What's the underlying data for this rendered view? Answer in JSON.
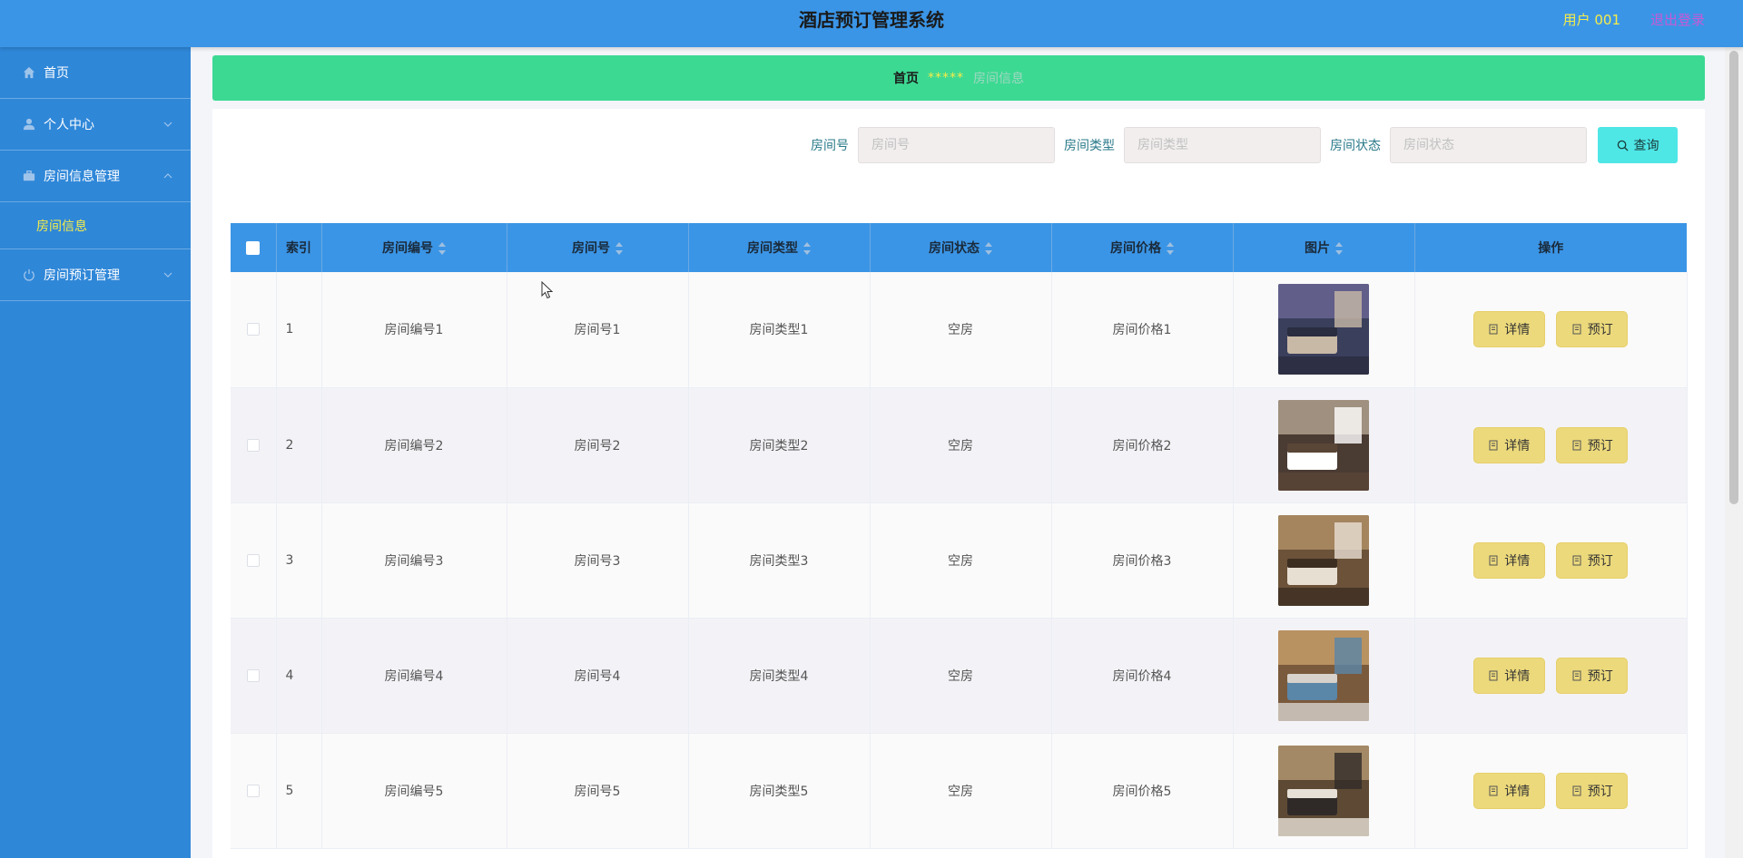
{
  "header": {
    "title": "酒店预订管理系统",
    "user": "用户 001",
    "logout": "退出登录",
    "bg_color": "#3b95e6",
    "user_color": "#f5ec4a",
    "logout_color": "#c65ad6"
  },
  "sidebar": {
    "bg_color": "#2f87d8",
    "items": [
      {
        "label": "首页",
        "icon": "home-icon"
      },
      {
        "label": "个人中心",
        "icon": "user-icon"
      },
      {
        "label": "房间信息管理",
        "icon": "briefcase-icon"
      },
      {
        "label": "房间信息",
        "icon": ""
      },
      {
        "label": "房间预订管理",
        "icon": "power-icon"
      }
    ]
  },
  "breadcrumb": {
    "home": "首页",
    "separator": "*****",
    "current": "房间信息"
  },
  "search": {
    "fields": [
      {
        "label": "房间号",
        "placeholder": "房间号"
      },
      {
        "label": "房间类型",
        "placeholder": "房间类型"
      },
      {
        "label": "房间状态",
        "placeholder": "房间状态"
      }
    ],
    "button": "查询"
  },
  "table": {
    "columns": [
      "索引",
      "房间编号",
      "房间号",
      "房间类型",
      "房间状态",
      "房间价格",
      "图片",
      "操作"
    ],
    "detail_label": "详情",
    "book_label": "预订",
    "rows": [
      {
        "index": "1",
        "room_code": "房间编号1",
        "room_no": "房间号1",
        "room_type": "房间类型1",
        "status": "空房",
        "price": "房间价格1",
        "image": "hotel-room-photo"
      },
      {
        "index": "2",
        "room_code": "房间编号2",
        "room_no": "房间号2",
        "room_type": "房间类型2",
        "status": "空房",
        "price": "房间价格2",
        "image": "hotel-room-photo"
      },
      {
        "index": "3",
        "room_code": "房间编号3",
        "room_no": "房间号3",
        "room_type": "房间类型3",
        "status": "空房",
        "price": "房间价格3",
        "image": "hotel-room-photo"
      },
      {
        "index": "4",
        "room_code": "房间编号4",
        "room_no": "房间号4",
        "room_type": "房间类型4",
        "status": "空房",
        "price": "房间价格4",
        "image": "hotel-room-photo"
      },
      {
        "index": "5",
        "room_code": "房间编号5",
        "room_no": "房间号5",
        "room_type": "房间类型5",
        "status": "空房",
        "price": "房间价格5",
        "image": "hotel-room-photo"
      }
    ]
  },
  "colors": {
    "breadcrumb_bg": "#3cd993",
    "search_button": "#4fe6e6",
    "action_button": "#ecd97b",
    "table_header": "#3b95e6"
  }
}
